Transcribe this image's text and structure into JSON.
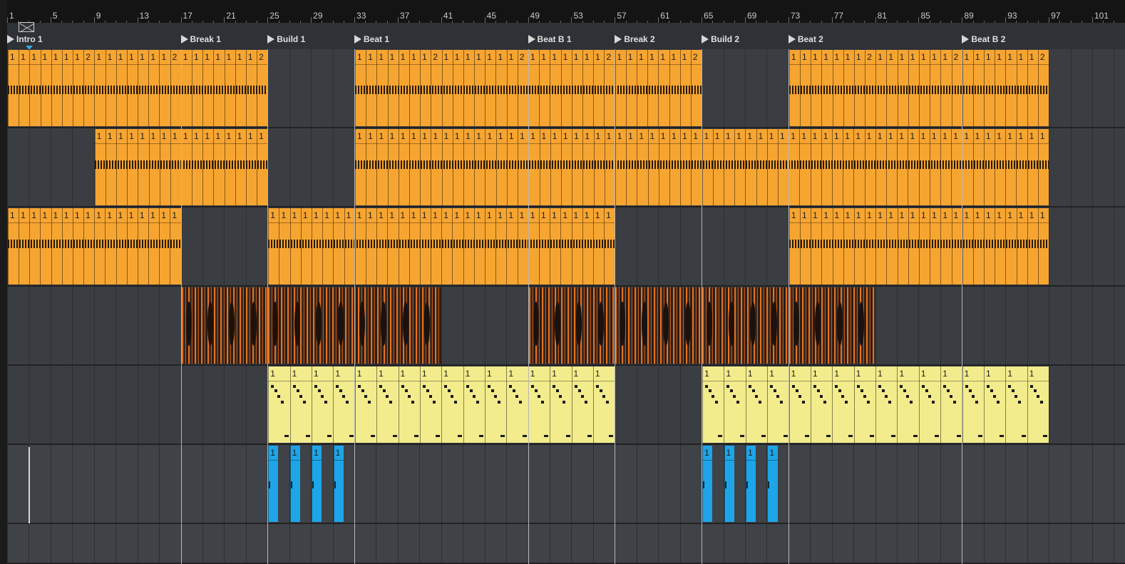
{
  "ruler": {
    "labels": [
      "1",
      "5",
      "9",
      "13",
      "17",
      "21",
      "25",
      "29",
      "33",
      "37",
      "41",
      "45",
      "49",
      "53",
      "57",
      "61",
      "65",
      "69",
      "73",
      "77",
      "81",
      "85",
      "89",
      "93",
      "97",
      "101"
    ]
  },
  "locators": [
    {
      "label": "Intro 1",
      "bar": 1
    },
    {
      "label": "Break 1",
      "bar": 17
    },
    {
      "label": "Build 1",
      "bar": 25
    },
    {
      "label": "Beat 1",
      "bar": 33
    },
    {
      "label": "Beat B 1",
      "bar": 49
    },
    {
      "label": "Break 2",
      "bar": 57
    },
    {
      "label": "Build 2",
      "bar": 65
    },
    {
      "label": "Beat 2",
      "bar": 73
    },
    {
      "label": "Beat B 2",
      "bar": 89
    }
  ],
  "colors": {
    "orange_clip": "#f7a531",
    "yellow_clip": "#f2ec8c",
    "blue_clip": "#1ea5e8",
    "audio_clip": "#3a2a22",
    "lane_bg": "#3a3d42"
  },
  "tracks": [
    {
      "type": "orange",
      "clips": [
        {
          "start": 1,
          "end": 25,
          "segments": [
            "1",
            "1",
            "1",
            "1",
            "1",
            "1",
            "1",
            "2",
            "1",
            "1",
            "1",
            "1",
            "1",
            "1",
            "1",
            "2",
            "1",
            "1",
            "1",
            "1",
            "1",
            "1",
            "1",
            "2"
          ]
        },
        {
          "start": 33,
          "end": 65,
          "segments": [
            "1",
            "1",
            "1",
            "1",
            "1",
            "1",
            "1",
            "2",
            "1",
            "1",
            "1",
            "1",
            "1",
            "1",
            "1",
            "2",
            "1",
            "1",
            "1",
            "1",
            "1",
            "1",
            "1",
            "2",
            "1",
            "1",
            "1",
            "1",
            "1",
            "1",
            "1",
            "2"
          ]
        },
        {
          "start": 73,
          "end": 97,
          "segments": [
            "1",
            "1",
            "1",
            "1",
            "1",
            "1",
            "1",
            "2",
            "1",
            "1",
            "1",
            "1",
            "1",
            "1",
            "1",
            "2",
            "1",
            "1",
            "1",
            "1",
            "1",
            "1",
            "1",
            "2"
          ]
        }
      ]
    },
    {
      "type": "orange",
      "clips": [
        {
          "start": 9,
          "end": 25,
          "segments": [
            "1",
            "1",
            "1",
            "1",
            "1",
            "1",
            "1",
            "1",
            "1",
            "1",
            "1",
            "1",
            "1",
            "1",
            "1",
            "1"
          ]
        },
        {
          "start": 33,
          "end": 97,
          "segments": [
            "1",
            "1",
            "1",
            "1",
            "1",
            "1",
            "1",
            "1",
            "1",
            "1",
            "1",
            "1",
            "1",
            "1",
            "1",
            "1",
            "1",
            "1",
            "1",
            "1",
            "1",
            "1",
            "1",
            "1",
            "1",
            "1",
            "1",
            "1",
            "1",
            "1",
            "1",
            "1",
            "1",
            "1",
            "1",
            "1",
            "1",
            "1",
            "1",
            "1",
            "1",
            "1",
            "1",
            "1",
            "1",
            "1",
            "1",
            "1",
            "1",
            "1",
            "1",
            "1",
            "1",
            "1",
            "1",
            "1",
            "1",
            "1",
            "1",
            "1",
            "1",
            "1",
            "1",
            "1"
          ]
        }
      ]
    },
    {
      "type": "orange",
      "clips": [
        {
          "start": 1,
          "end": 17,
          "segments": [
            "1",
            "1",
            "1",
            "1",
            "1",
            "1",
            "1",
            "1",
            "1",
            "1",
            "1",
            "1",
            "1",
            "1",
            "1",
            "1"
          ]
        },
        {
          "start": 25,
          "end": 57,
          "segments": [
            "1",
            "1",
            "1",
            "1",
            "1",
            "1",
            "1",
            "1",
            "1",
            "1",
            "1",
            "1",
            "1",
            "1",
            "1",
            "1",
            "1",
            "1",
            "1",
            "1",
            "1",
            "1",
            "1",
            "1",
            "1",
            "1",
            "1",
            "1",
            "1",
            "1",
            "1",
            "1"
          ]
        },
        {
          "start": 73,
          "end": 97,
          "segments": [
            "1",
            "1",
            "1",
            "1",
            "1",
            "1",
            "1",
            "1",
            "1",
            "1",
            "1",
            "1",
            "1",
            "1",
            "1",
            "1",
            "1",
            "1",
            "1",
            "1",
            "1",
            "1",
            "1",
            "1"
          ]
        }
      ]
    },
    {
      "type": "audio",
      "clips": [
        {
          "start": 17,
          "end": 25
        },
        {
          "start": 25,
          "end": 41
        },
        {
          "start": 49,
          "end": 57
        },
        {
          "start": 57,
          "end": 65
        },
        {
          "start": 65,
          "end": 73
        },
        {
          "start": 73,
          "end": 81
        }
      ]
    },
    {
      "type": "yellow",
      "clips": [
        {
          "start": 25,
          "end": 57,
          "segments": [
            "1",
            "1",
            "1",
            "1",
            "1",
            "1",
            "1",
            "1",
            "1",
            "1",
            "1",
            "1",
            "1",
            "1",
            "1",
            "1"
          ]
        },
        {
          "start": 65,
          "end": 97,
          "segments": [
            "1",
            "1",
            "1",
            "1",
            "1",
            "1",
            "1",
            "1",
            "1",
            "1",
            "1",
            "1",
            "1",
            "1",
            "1",
            "1"
          ]
        }
      ]
    },
    {
      "type": "blue",
      "clips": [
        {
          "start": 25,
          "end": 26,
          "segments": [
            "1"
          ]
        },
        {
          "start": 27,
          "end": 28,
          "segments": [
            "1"
          ]
        },
        {
          "start": 29,
          "end": 30,
          "segments": [
            "1"
          ]
        },
        {
          "start": 31,
          "end": 32,
          "segments": [
            "1"
          ]
        },
        {
          "start": 65,
          "end": 66,
          "segments": [
            "1"
          ]
        },
        {
          "start": 67,
          "end": 68,
          "segments": [
            "1"
          ]
        },
        {
          "start": 69,
          "end": 70,
          "segments": [
            "1"
          ]
        },
        {
          "start": 71,
          "end": 72,
          "segments": [
            "1"
          ]
        }
      ]
    },
    {
      "type": "empty",
      "clips": []
    }
  ]
}
